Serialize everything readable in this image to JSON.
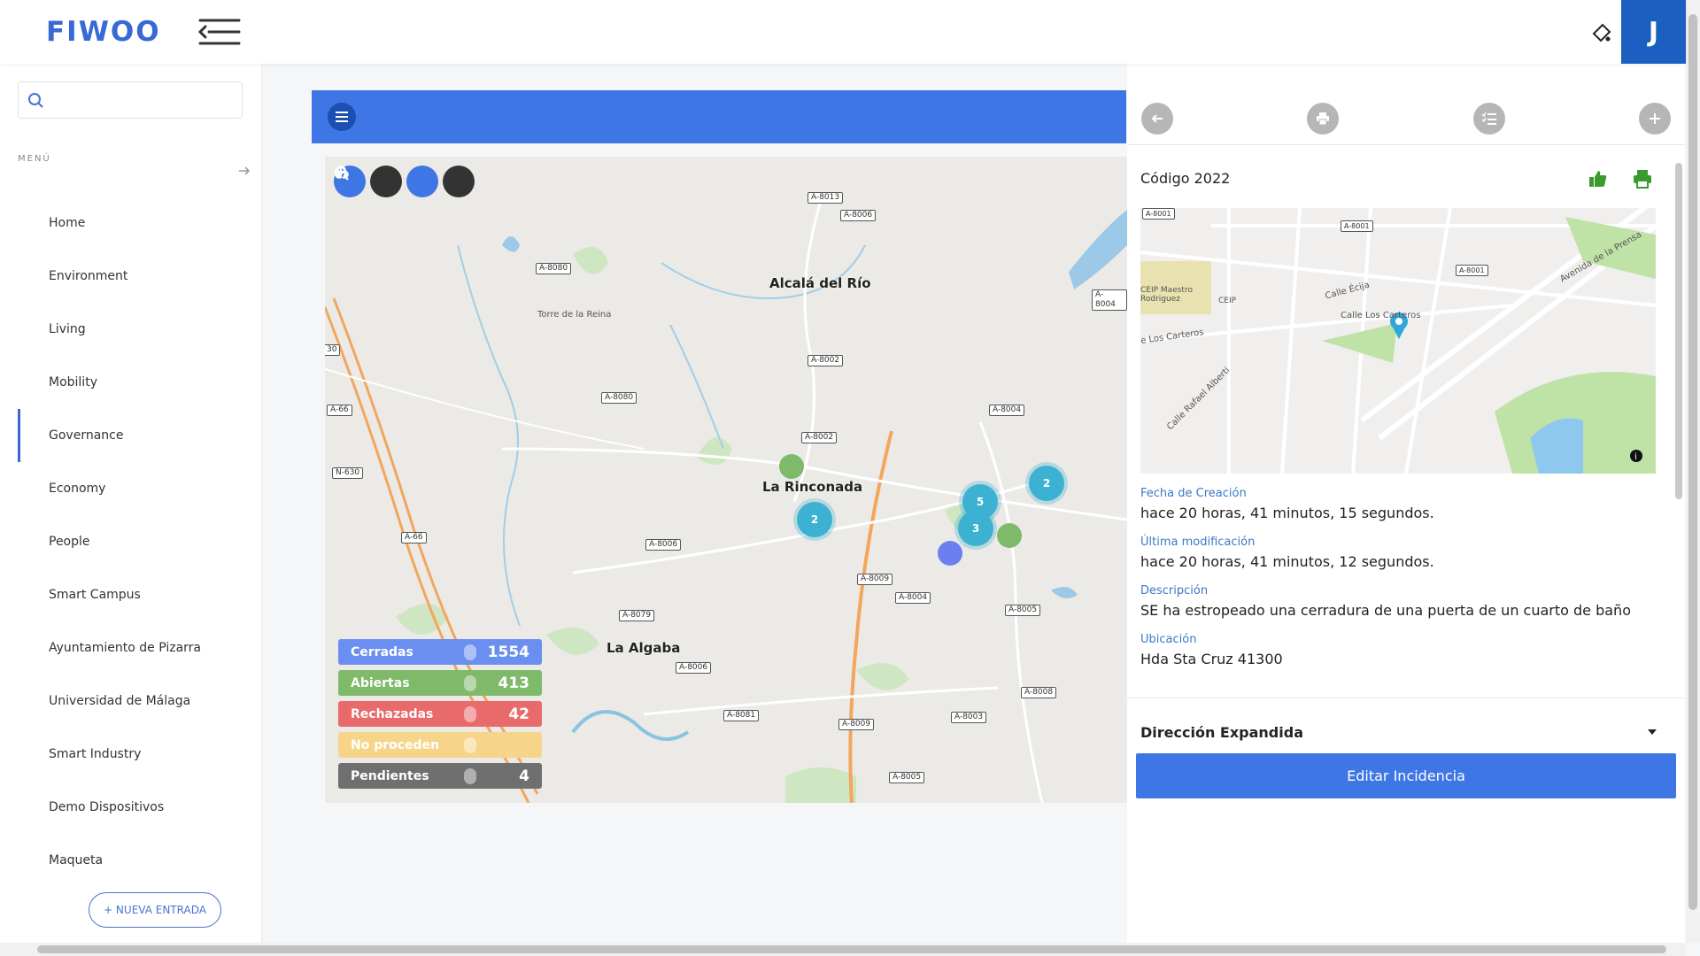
{
  "app": {
    "logo": "FIWOO",
    "user_initial": "J"
  },
  "sidebar": {
    "search_placeholder": "",
    "menu_label": "MENÚ",
    "items": [
      {
        "label": "Home"
      },
      {
        "label": "Environment"
      },
      {
        "label": "Living"
      },
      {
        "label": "Mobility"
      },
      {
        "label": "Governance",
        "active": true
      },
      {
        "label": "Economy"
      },
      {
        "label": "People"
      },
      {
        "label": "Smart Campus"
      },
      {
        "label": "Ayuntamiento de Pizarra"
      },
      {
        "label": "Universidad de Málaga"
      },
      {
        "label": "Smart Industry"
      },
      {
        "label": "Demo Dispositivos"
      },
      {
        "label": "Maqueta"
      }
    ],
    "new_entry": "+ NUEVA ENTRADA"
  },
  "map": {
    "places": {
      "alcala": "Alcalá del Río",
      "rinconada": "La Rinconada",
      "algaba": "La Algaba",
      "torre": "Torre de la Reina"
    },
    "roads": [
      "A-8013",
      "A-8006",
      "A-8080",
      "A-8004",
      "A-8002",
      "A-8080",
      "A-8002",
      "A-8004",
      "A-66",
      "N-630",
      "A-66",
      "A-8006",
      "A-8009",
      "A-8004",
      "A-8005",
      "A-8079",
      "A-8006",
      "A-8081",
      "A-8009",
      "A-8003",
      "A-8008",
      "A-8005",
      "30"
    ],
    "clusters": [
      {
        "count": "2"
      },
      {
        "count": "5"
      },
      {
        "count": "3"
      },
      {
        "count": "2"
      }
    ],
    "legend": [
      {
        "label": "Cerradas",
        "value": "1554",
        "color": "#6b8ff0"
      },
      {
        "label": "Abiertas",
        "value": "413",
        "color": "#7fb96a"
      },
      {
        "label": "Rechazadas",
        "value": "42",
        "color": "#e86a6a"
      },
      {
        "label": "No proceden",
        "value": "",
        "color": "#f6d58a"
      },
      {
        "label": "Pendientes",
        "value": "4",
        "color": "#6f6f6f"
      }
    ]
  },
  "detail": {
    "code": "Código 2022",
    "minimap_labels": {
      "a8001a": "A-8001",
      "a8001b": "A-8001",
      "a8001c": "A-8001",
      "ceip1": "CEIP Maestro Rodriguez",
      "ceip2": "CEIP",
      "ecija": "Calle Écija",
      "carteros": "Calle Los Carteros",
      "carteros2": "e Los Carteros",
      "rafael": "Calle Rafael Alberti",
      "prensa": "Avenida de la Prensa"
    },
    "fields": [
      {
        "label": "Fecha de Creación",
        "value": "hace 20 horas, 41 minutos, 15 segundos."
      },
      {
        "label": "Última modificación",
        "value": "hace 20 horas, 41 minutos, 12 segundos."
      },
      {
        "label": "Descripción",
        "value": "SE ha estropeado una cerradura de una puerta de un cuarto de baño"
      },
      {
        "label": "Ubicación",
        "value": "Hda Sta Cruz 41300"
      }
    ],
    "expand_title": "Dirección Expandida",
    "edit_button": "Editar Incidencia"
  },
  "colors": {
    "accent": "#3e76e6",
    "brand": "#3869d4",
    "avatar": "#1b5fc1",
    "cluster": "#3cb1d2"
  }
}
